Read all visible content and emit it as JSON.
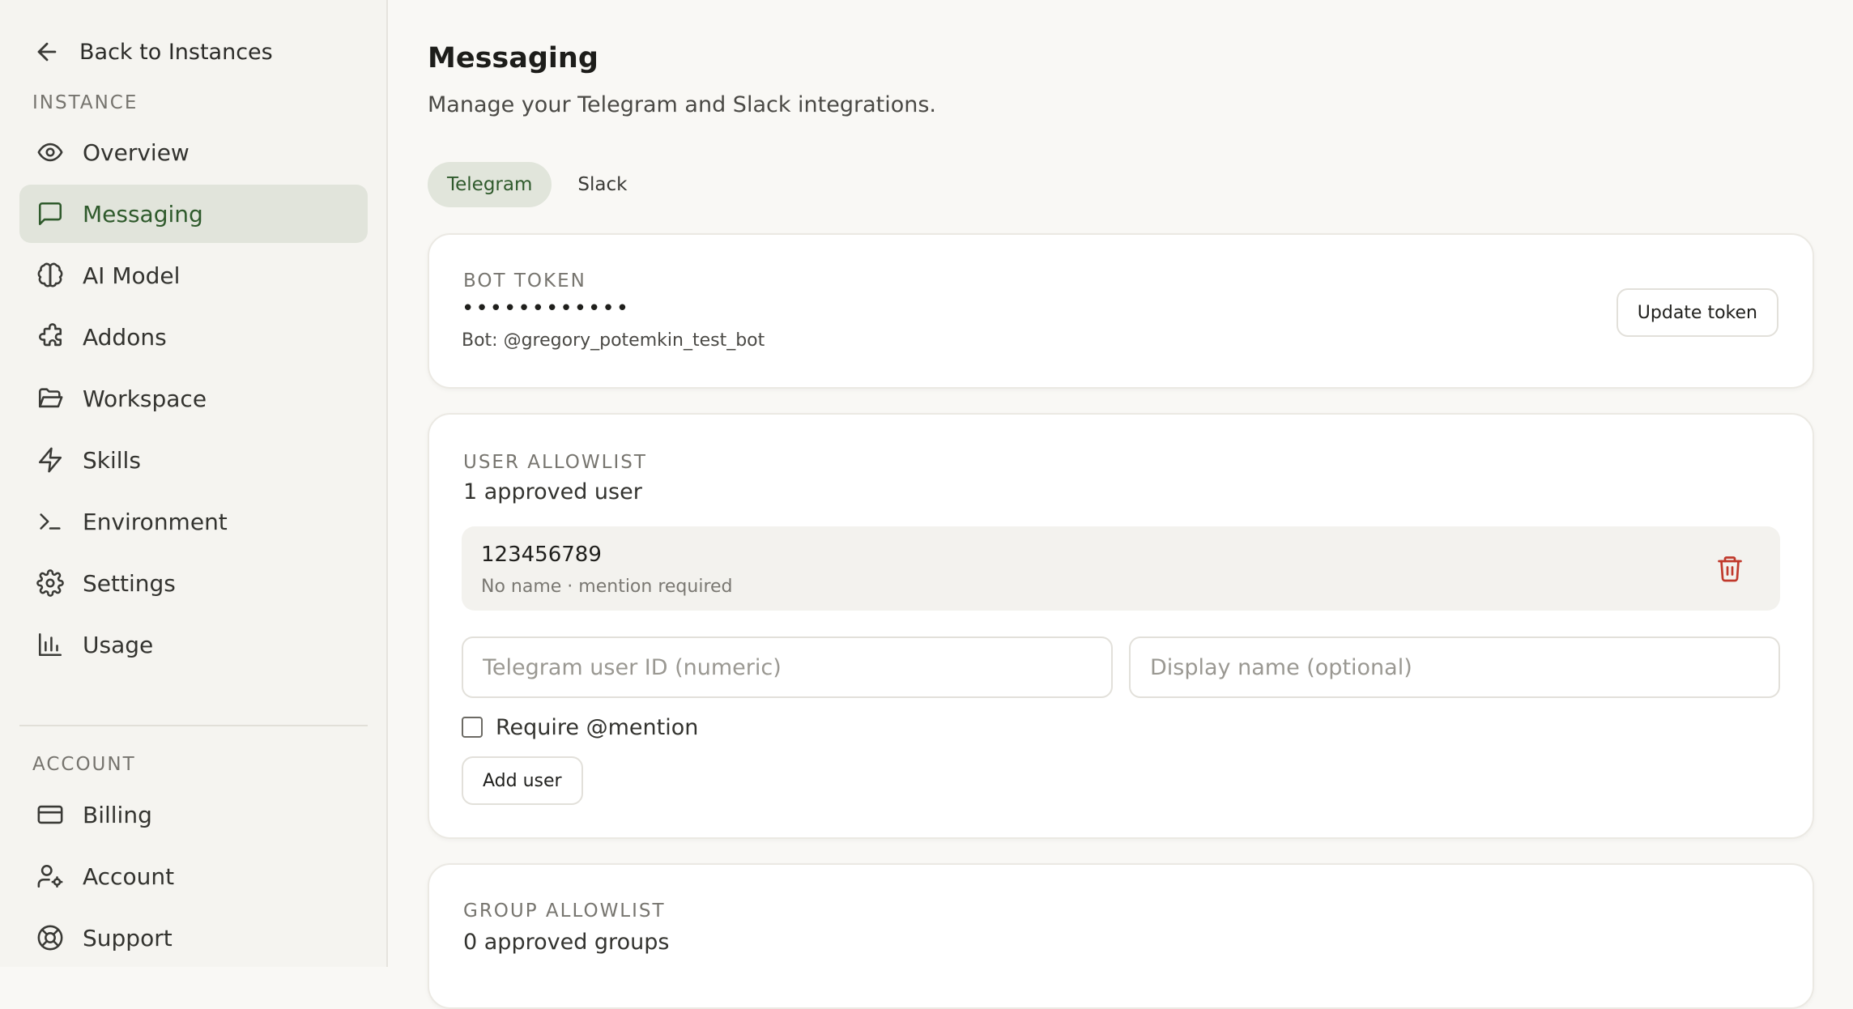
{
  "sidebar": {
    "back_label": "Back to Instances",
    "instance_section": "INSTANCE",
    "account_section": "ACCOUNT",
    "items": [
      {
        "label": "Overview",
        "icon": "eye-icon"
      },
      {
        "label": "Messaging",
        "icon": "message-square-icon"
      },
      {
        "label": "AI Model",
        "icon": "brain-icon"
      },
      {
        "label": "Addons",
        "icon": "puzzle-icon"
      },
      {
        "label": "Workspace",
        "icon": "folder-open-icon"
      },
      {
        "label": "Skills",
        "icon": "zap-icon"
      },
      {
        "label": "Environment",
        "icon": "terminal-icon"
      },
      {
        "label": "Settings",
        "icon": "gear-icon"
      },
      {
        "label": "Usage",
        "icon": "bar-chart-icon"
      }
    ],
    "account_items": [
      {
        "label": "Billing",
        "icon": "credit-card-icon"
      },
      {
        "label": "Account",
        "icon": "user-cog-icon"
      },
      {
        "label": "Support",
        "icon": "life-buoy-icon"
      }
    ],
    "active_item": "Messaging"
  },
  "main": {
    "title": "Messaging",
    "subtitle": "Manage your Telegram and Slack integrations.",
    "tabs": [
      {
        "label": "Telegram",
        "active": true
      },
      {
        "label": "Slack",
        "active": false
      }
    ],
    "bot_token": {
      "label": "BOT TOKEN",
      "masked_value": "••••••••••••",
      "bot_name": "Bot: @gregory_potemkin_test_bot",
      "update_button": "Update token"
    },
    "user_allowlist": {
      "label": "USER ALLOWLIST",
      "count_text": "1 approved user",
      "users": [
        {
          "id": "123456789",
          "meta": "No name  · mention required"
        }
      ],
      "user_id_placeholder": "Telegram user ID (numeric)",
      "display_name_placeholder": "Display name (optional)",
      "require_mention_label": "Require @mention",
      "add_button": "Add user"
    },
    "group_allowlist": {
      "label": "GROUP ALLOWLIST",
      "count_text": "0 approved groups"
    }
  },
  "colors": {
    "accent": "#2f5a2c",
    "active_bg": "#e1e4db",
    "danger": "#c0392b",
    "background": "#f9f8f5"
  }
}
